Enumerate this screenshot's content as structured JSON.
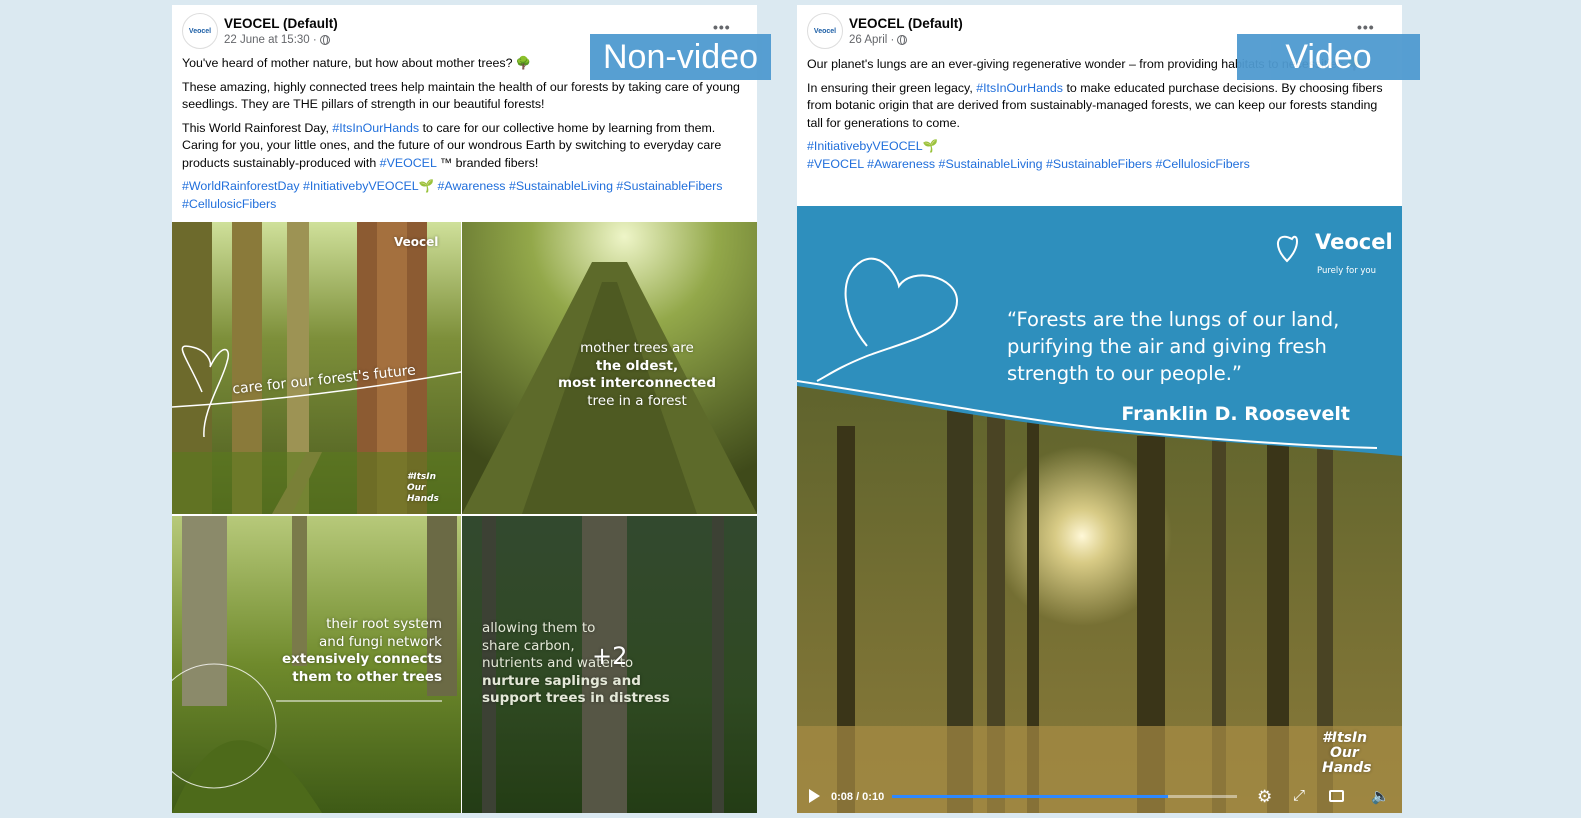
{
  "colors": {
    "page_bg": "#dbe9f1",
    "hashtag": "#216fdb",
    "label_bg": "#4f9ad0",
    "video_blue": "#2e8fbd"
  },
  "labels": {
    "left": "Non-video",
    "right": "Video"
  },
  "left_post": {
    "page_name": "VEOCEL (Default)",
    "timestamp": "22 June at 15:30 ·",
    "menu": "•••",
    "p1": "You've heard of mother nature, but how about mother trees? 🌳",
    "p2": "These amazing, highly connected trees help maintain the health of our forests by taking care of young seedlings. They are THE pillars of strength in our beautiful forests!",
    "p3_a": "This World Rainforest Day, ",
    "p3_tag1": "#ItsInOurHands",
    "p3_b": " to care for our collective home by learning from them. Caring for you, your little ones, and the future of our wondrous Earth by switching to everyday care products sustainably-produced with ",
    "p3_tag2": "#VEOCEL",
    "p3_c": " ™ branded fibers!",
    "hashtags": "#WorldRainforestDay #InitiativebyVEOCEL🌱 #Awareness #SustainableLiving #SustainableFibers #CellulosicFibers",
    "tiles": {
      "t1_text": "care for our forest's future",
      "t1_logo": "Veocel",
      "t1_badge": "#ItsIn Our Hands",
      "t2_line1": "mother trees are",
      "t2_line2": "the oldest,",
      "t2_line3": "most interconnected",
      "t2_line4": "tree in a forest",
      "t3_line1": "their root system",
      "t3_line2": "and fungi network",
      "t3_line3": "extensively connects",
      "t3_line4": "them to other trees",
      "t4_line1": "allowing them to",
      "t4_line2": "share carbon,",
      "t4_line3": "nutrients and water to",
      "t4_line4": "nurture saplings and",
      "t4_line5": "support trees in distress",
      "more": "+2"
    }
  },
  "right_post": {
    "page_name": "VEOCEL (Default)",
    "timestamp": "26 April ·",
    "menu": "•••",
    "p1": "Our planet's lungs are an ever-giving regenerative wonder – from providing habitats to necessities 🌳",
    "p2_a": "In ensuring their green legacy, ",
    "p2_tag": "#ItsInOurHands",
    "p2_b": " to make educated purchase decisions. By choosing fibers from botanic origin that are derived from sustainably-managed forests, we can keep our forests standing tall for generations to come.",
    "hashtag_line1": "#InitiativebyVEOCEL🌱",
    "hashtag_line2": "#VEOCEL #Awareness #SustainableLiving #SustainableFibers #CellulosicFibers",
    "video": {
      "logo": "Veocel",
      "tagline": "Purely for you",
      "quote1": "“Forests are the lungs of our land,",
      "quote2": "purifying the air and giving fresh",
      "quote3": "strength to our people.”",
      "author": "Franklin D. Roosevelt",
      "badge1": "#ItsIn",
      "badge2": "Our",
      "badge3": "Hands",
      "time": "0:08 / 0:10",
      "progress": 0.8
    }
  }
}
